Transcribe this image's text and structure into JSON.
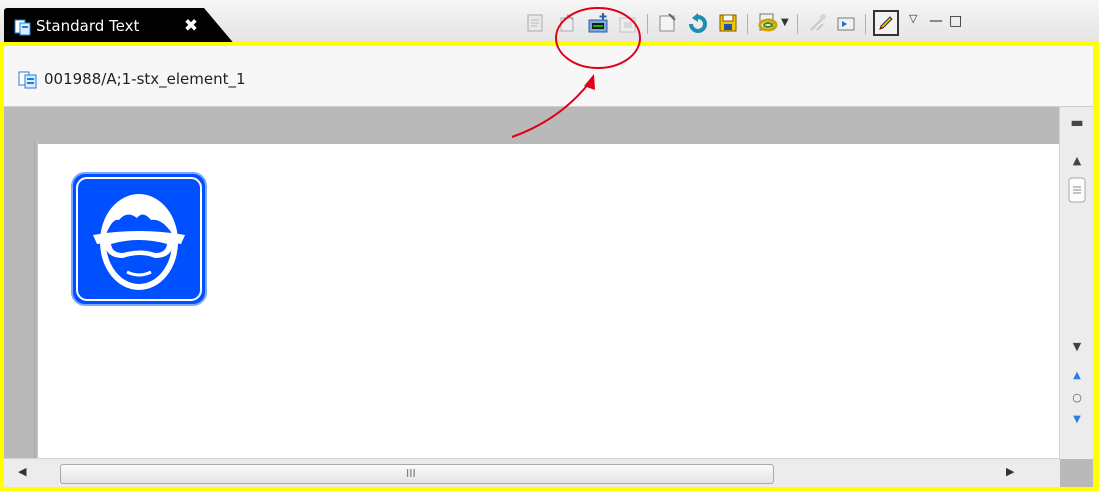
{
  "tab": {
    "label": "Standard Text",
    "close_glyph": "✖"
  },
  "editor": {
    "document_title": "001988/A;1-stx_element_1"
  },
  "toolbar": {
    "icons": [
      "edit-properties-icon",
      "check-out-icon",
      "insert-object-icon",
      "disabled-insert-icon",
      "properties-icon",
      "back-icon",
      "save-icon",
      "link-icon",
      "dropdown-arrow-icon",
      "disabled-tool-icon",
      "view-icon",
      "edit-pencil-icon"
    ]
  },
  "view_menu": {
    "minimize_glyph": "▭",
    "maximize_glyph": "□",
    "menu_glyph": "▽"
  },
  "scrollbar": {
    "grip": "III"
  },
  "colors": {
    "frame": "#ffff00",
    "tab": "#000000",
    "accent_blue": "#0050ff",
    "annotation": "#e0001a"
  },
  "image": {
    "subject": "safety-goggles-sign"
  }
}
